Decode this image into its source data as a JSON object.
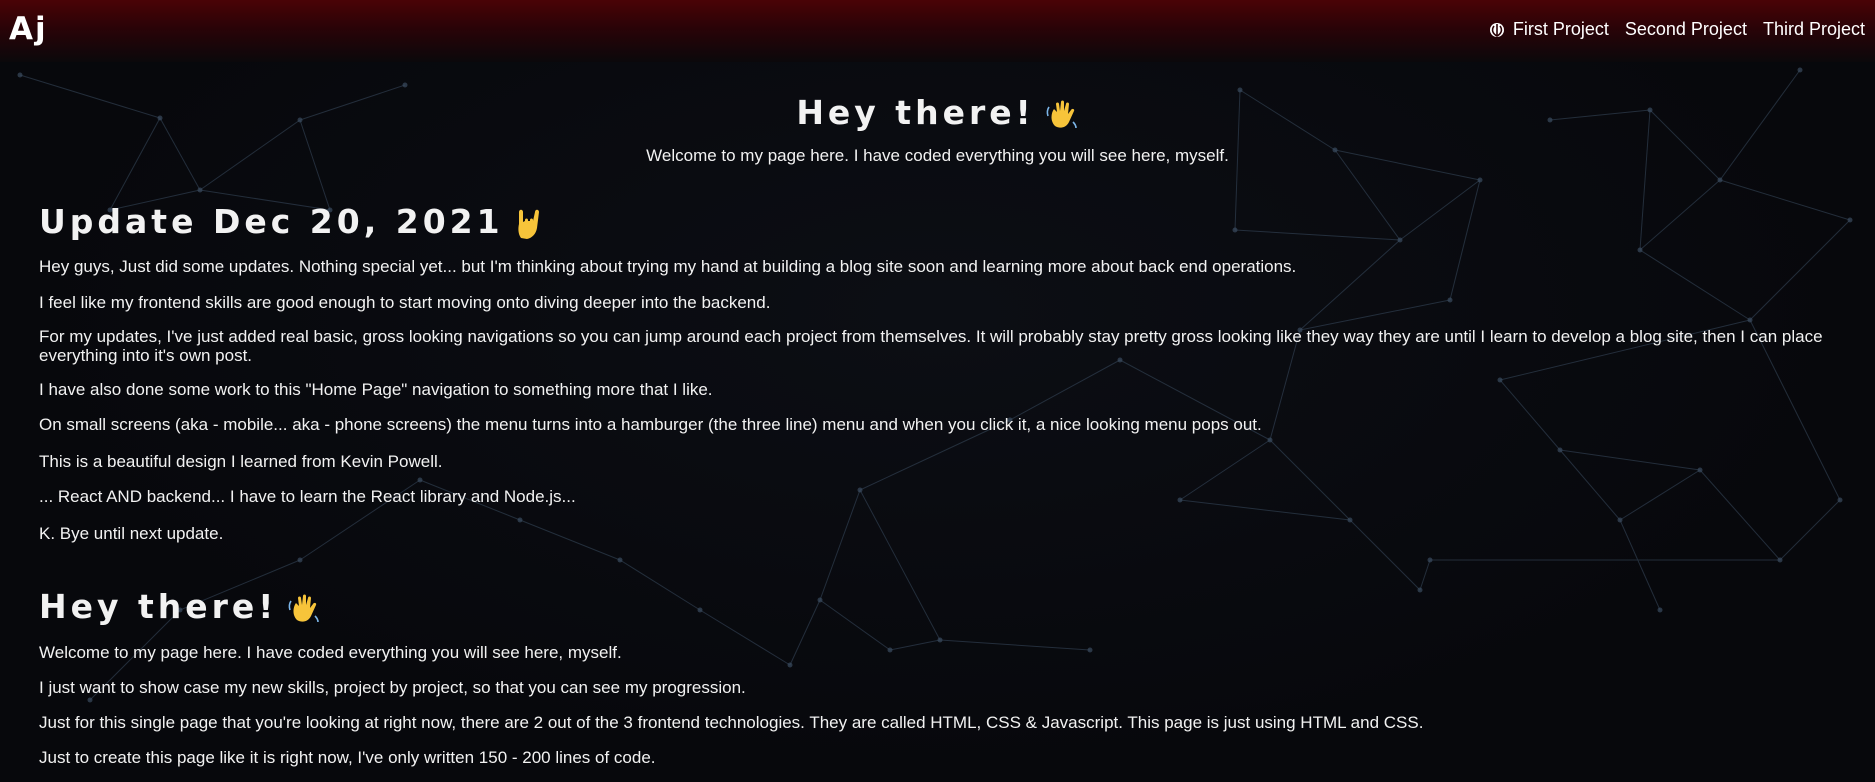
{
  "header": {
    "logo": "Aj",
    "nav": [
      {
        "label": "First Project"
      },
      {
        "label": "Second Project"
      },
      {
        "label": "Third Project"
      }
    ],
    "icon": "rebel-alliance-icon"
  },
  "hero": {
    "title": "Hey there!",
    "emoji": "waving-hand-icon",
    "subtitle": "Welcome to my page here. I have coded everything you will see here, myself."
  },
  "update": {
    "title": "Update Dec 20, 2021",
    "emoji": "sign-of-the-horns-icon",
    "paragraphs": [
      "Hey guys, Just did some updates. Nothing special yet... but I'm thinking about trying my hand at building a blog site soon and learning more about back end operations.",
      "I feel like my frontend skills are good enough to start moving onto diving deeper into the backend.",
      "For my updates, I've just added real basic, gross looking navigations so you can jump around each project from themselves. It will probably stay pretty gross looking like they way they are until I learn to develop a blog site, then I can place everything into it's own post.",
      "I have also done some work to this \"Home Page\" navigation to something more that I like.",
      "On small screens (aka - mobile... aka - phone screens) the menu turns into a hamburger (the three line) menu and when you click it, a nice looking menu pops out.",
      "This is a beautiful design I learned from Kevin Powell.",
      "... React AND backend... I have to learn the React library and Node.js...",
      "K. Bye until next update."
    ]
  },
  "intro": {
    "title": "Hey there!",
    "emoji": "waving-hand-icon",
    "paragraphs": [
      "Welcome to my page here. I have coded everything you will see here, myself.",
      "I just want to show case my new skills, project by project, so that you can see my progression.",
      "Just for this single page that you're looking at right now, there are 2 out of the 3 frontend technologies. They are called HTML, CSS & Javascript. This page is just using HTML and CSS.",
      "Just to create this page like it is right now, I've only written 150 - 200 lines of code."
    ]
  },
  "colors": {
    "header_top": "#4a0306",
    "background": "#07080c",
    "network_line": "#3a4c60",
    "text": "#ffffff"
  }
}
